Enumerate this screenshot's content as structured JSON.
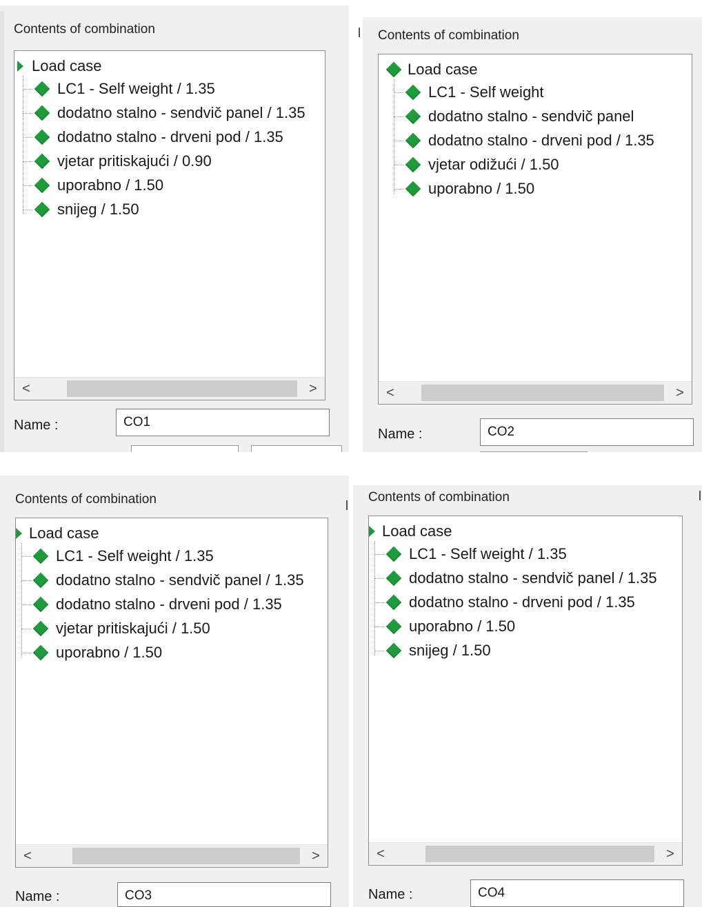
{
  "panels": [
    {
      "header": "Contents of combination",
      "root": "Load case",
      "items": [
        "LC1 - Self weight / 1.35",
        "dodatno stalno - sendvič panel / 1.35",
        "dodatno stalno - drveni pod / 1.35",
        "vjetar pritiskajući / 0.90",
        "uporabno / 1.50",
        "snijeg / 1.50"
      ],
      "name_label": "Name :",
      "name_value": "CO1"
    },
    {
      "header": "Contents of combination",
      "root": "Load case",
      "items": [
        "LC1 - Self weight",
        "dodatno stalno - sendvič panel",
        "dodatno stalno - drveni pod / 1.35",
        "vjetar odižući / 1.50",
        "uporabno / 1.50"
      ],
      "name_label": "Name :",
      "name_value": "CO2"
    },
    {
      "header": "Contents of combination",
      "root": "Load case",
      "items": [
        "LC1 - Self weight / 1.35",
        "dodatno stalno - sendvič panel / 1.35",
        "dodatno stalno - drveni pod / 1.35",
        "vjetar pritiskajući / 1.50",
        "uporabno / 1.50"
      ],
      "name_label": "Name :",
      "name_value": "CO3"
    },
    {
      "header": "Contents of combination",
      "root": "Load case",
      "items": [
        "LC1 - Self weight / 1.35",
        "dodatno stalno - sendvič panel / 1.35",
        "dodatno stalno - drveni pod / 1.35",
        "uporabno / 1.50",
        "snijeg / 1.50"
      ],
      "name_label": "Name :",
      "name_value": "CO4"
    }
  ],
  "icons": {
    "tree_item": "diamond-icon",
    "tree_root": "arrow-icon",
    "scroll_left": "chevron-left-icon",
    "scroll_right": "chevron-right-icon"
  },
  "colors": {
    "diamond": "#1f9b3b",
    "panel_bg": "#f0f0f0"
  }
}
